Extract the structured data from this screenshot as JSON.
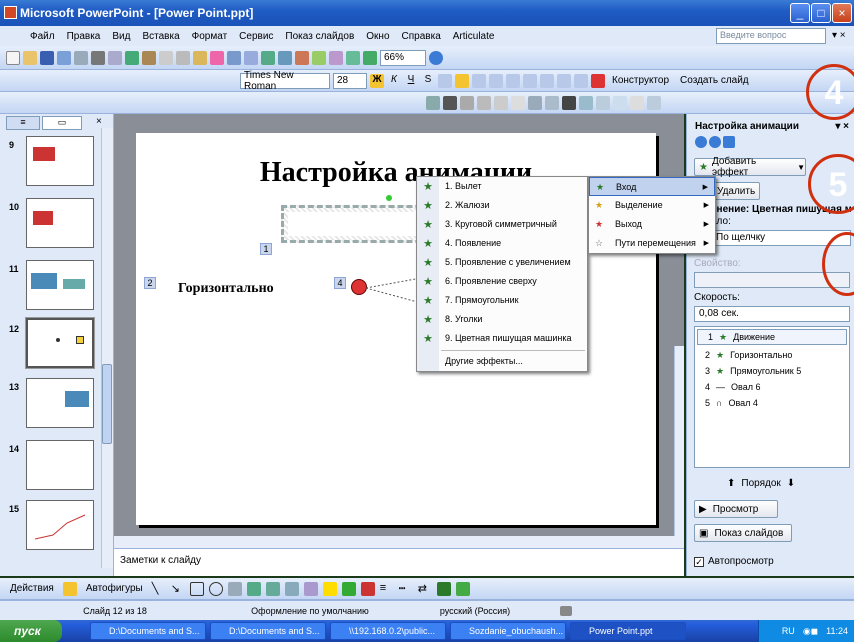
{
  "window": {
    "title": "Microsoft PowerPoint - [Power Point.ppt]"
  },
  "menubar": {
    "items": [
      "Файл",
      "Правка",
      "Вид",
      "Вставка",
      "Формат",
      "Сервис",
      "Показ слайдов",
      "Окно",
      "Справка",
      "Articulate"
    ],
    "help_placeholder": "Введите вопрос"
  },
  "toolbar": {
    "zoom": "66%"
  },
  "format_toolbar": {
    "font": "Times New Roman",
    "size": "28",
    "designer": "Конструктор",
    "new_slide": "Создать слайд"
  },
  "slides_pane": {
    "numbers": [
      "9",
      "10",
      "11",
      "12",
      "13",
      "14",
      "15"
    ]
  },
  "slide": {
    "title": "Настройка анимации",
    "subtitle": "Движение",
    "tags": [
      "1",
      "2",
      "4"
    ],
    "horizontal_label": "Горизонтально"
  },
  "notes": {
    "placeholder": "Заметки к слайду"
  },
  "context_menu": {
    "items": [
      "1. Вылет",
      "2. Жалюзи",
      "3. Круговой симметричный",
      "4. Появление",
      "5. Проявление с увеличением",
      "6. Проявление сверху",
      "7. Прямоугольник",
      "8. Уголки",
      "9. Цветная пишущая машинка"
    ],
    "more": "Другие эффекты..."
  },
  "submenu": {
    "items": [
      "Вход",
      "Выделение",
      "Выход",
      "Пути перемещения"
    ]
  },
  "anim_pane": {
    "title": "Настройка анимации",
    "add_effect": "Добавить эффект",
    "remove": "Удалить",
    "effect_label": "енение: Цветная пишущая м",
    "start_label": "ало:",
    "start_value": "По щелчку",
    "property_label": "Свойство:",
    "speed_label": "Скорость:",
    "speed_value": "0,08 сек.",
    "list": [
      {
        "num": "1",
        "name": "Движение"
      },
      {
        "num": "2",
        "name": "Горизонтально"
      },
      {
        "num": "3",
        "name": "Прямоугольник 5"
      },
      {
        "num": "4",
        "name": "Овал 6"
      },
      {
        "num": "5",
        "name": "Овал 4"
      }
    ],
    "order": "Порядок",
    "preview": "Просмотр",
    "slideshow": "Показ слайдов",
    "autopreview": "Автопросмотр"
  },
  "callouts": [
    "4",
    "5"
  ],
  "drawbar": {
    "actions": "Действия",
    "autoshapes": "Автофигуры"
  },
  "statusbar": {
    "slide": "Слайд 12 из 18",
    "design": "Оформление по умолчанию",
    "lang": "русский (Россия)"
  },
  "taskbar": {
    "start": "пуск",
    "tasks": [
      "D:\\Documents and S...",
      "D:\\Documents and S...",
      "\\\\192.168.0.2\\public...",
      "Sozdanie_obuchaush...",
      "Power Point.ppt"
    ],
    "lang": "RU",
    "time": "11:24"
  },
  "colors": {
    "accent": "#316ac5",
    "titlebar": "#1f5cc4",
    "callout": "#d03010",
    "start": "#2c8a2c"
  }
}
